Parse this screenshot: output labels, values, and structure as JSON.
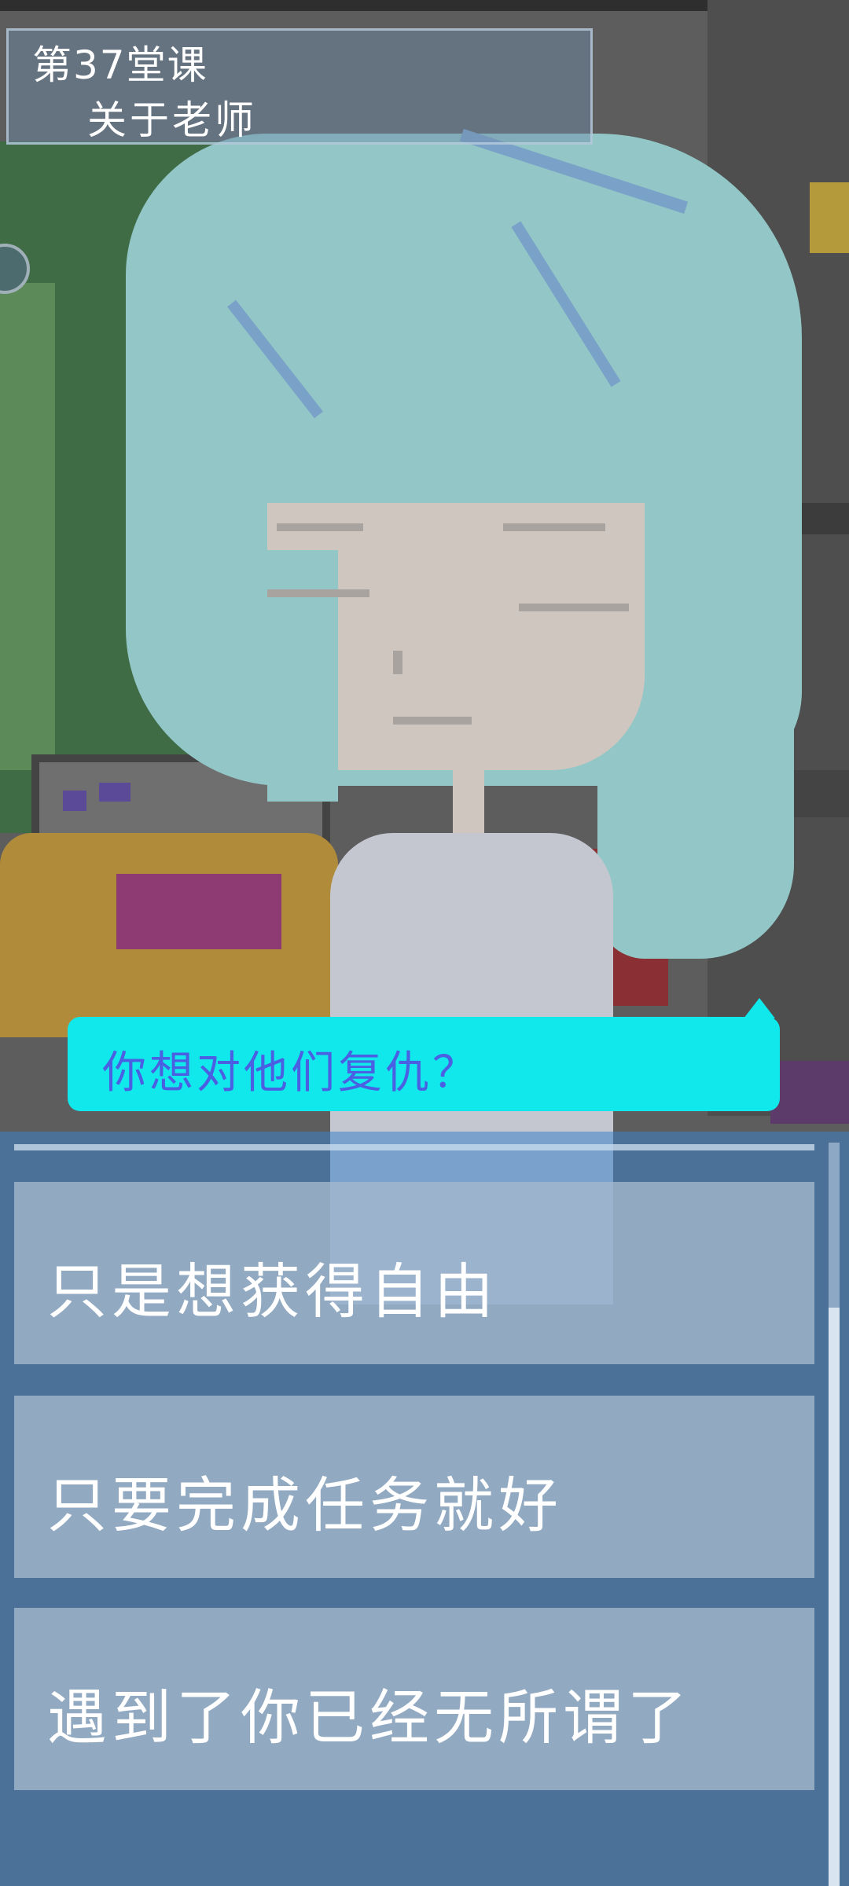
{
  "lesson": {
    "number_label": "第37堂课",
    "title": "关于老师"
  },
  "dialogue": {
    "text": "你想对他们复仇？"
  },
  "choices": [
    {
      "label": "只是想获得自由"
    },
    {
      "label": "只要完成任务就好"
    },
    {
      "label": "遇到了你已经无所谓了"
    }
  ],
  "colors": {
    "bubble_bg": "#10e8ec",
    "bubble_text": "#4a5fe2",
    "panel_bg": "#3c82c8",
    "choice_bg": "#a5b9cd"
  }
}
